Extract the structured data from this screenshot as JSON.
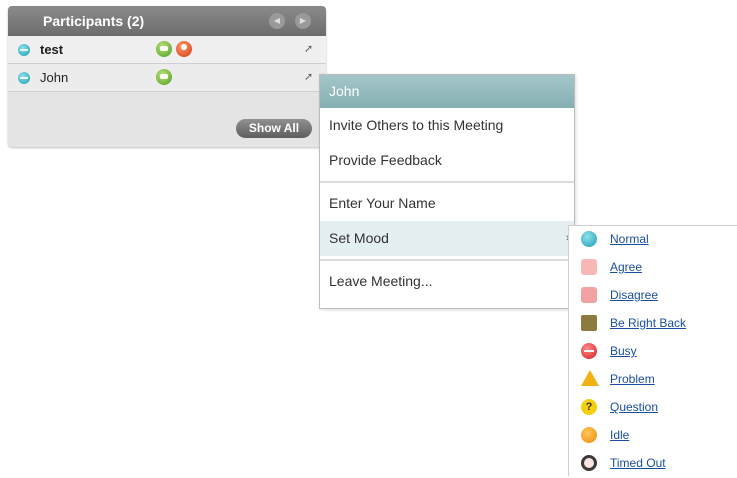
{
  "participants": {
    "title": "Participants (2)",
    "show_all": "Show All",
    "rows": [
      {
        "name": "test"
      },
      {
        "name": "John"
      }
    ]
  },
  "context_menu": {
    "header": "John",
    "items": [
      "Invite Others to this Meeting",
      "Provide Feedback",
      "Enter Your Name",
      "Set Mood",
      "Leave Meeting..."
    ],
    "submenu_arrow": "»"
  },
  "moods": [
    {
      "label": "Normal",
      "icon": "normal-icon"
    },
    {
      "label": "Agree",
      "icon": "thumbs-up-icon"
    },
    {
      "label": "Disagree",
      "icon": "thumbs-down-icon"
    },
    {
      "label": "Be Right Back",
      "icon": "door-icon"
    },
    {
      "label": "Busy",
      "icon": "busy-icon"
    },
    {
      "label": "Problem",
      "icon": "warning-icon"
    },
    {
      "label": "Question",
      "icon": "question-icon"
    },
    {
      "label": "Idle",
      "icon": "idle-icon"
    },
    {
      "label": "Timed Out",
      "icon": "timed-out-icon"
    }
  ],
  "colors": {
    "header_gray": "#6d6d6d",
    "menu_header_teal": "#86afb3",
    "link_blue": "#1a4fa0"
  }
}
